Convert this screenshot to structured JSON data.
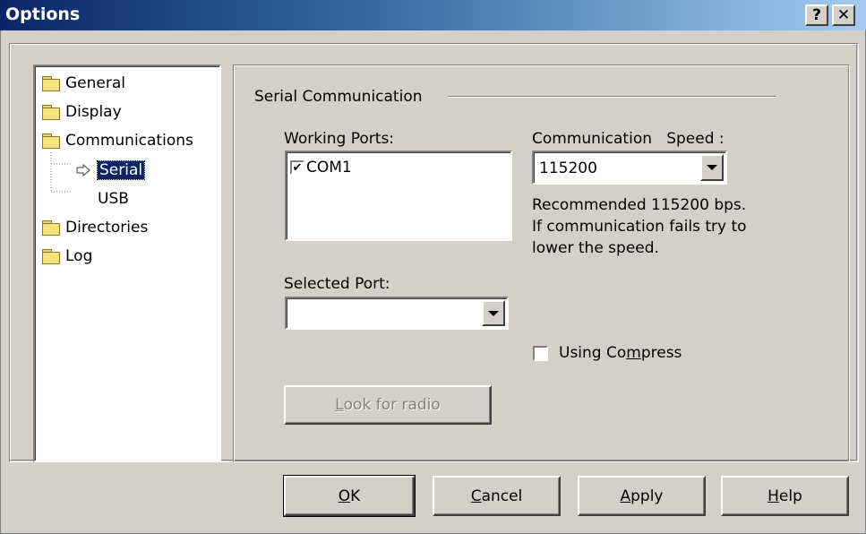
{
  "window": {
    "title": "Options",
    "help_glyph": "?",
    "close_glyph": "✕"
  },
  "tree": {
    "items": [
      {
        "label": "General",
        "icon": "folder-icon"
      },
      {
        "label": "Display",
        "icon": "folder-icon"
      },
      {
        "label": "Communications",
        "icon": "folder-icon"
      },
      {
        "label": "Serial",
        "icon": "arrow-right-icon",
        "selected": true
      },
      {
        "label": "USB"
      },
      {
        "label": "Directories",
        "icon": "folder-icon"
      },
      {
        "label": "Log",
        "icon": "folder-icon"
      }
    ]
  },
  "serial": {
    "group_label": "Serial Communication",
    "working_ports_label": "Working Ports:",
    "ports": [
      {
        "name": "COM1",
        "checked": true
      }
    ],
    "speed_label": "Communication   Speed :",
    "speed_value": "115200",
    "note_line1": "Recommended 115200 bps.",
    "note_line2": "If communication fails try to",
    "note_line3": "lower the speed.",
    "selected_port_label": "Selected Port:",
    "selected_port_value": "",
    "compress_pre": "Using Co",
    "compress_acc": "m",
    "compress_post": "press",
    "compress_checked": false,
    "look_acc": "L",
    "look_rest": "ook for radio"
  },
  "buttons": {
    "ok_acc": "O",
    "ok_rest": "K",
    "cancel_acc": "C",
    "cancel_rest": "ancel",
    "apply_acc": "A",
    "apply_rest": "pply",
    "help_acc": "H",
    "help_rest": "elp"
  },
  "colors": {
    "face": "#d4d0c8",
    "title_start": "#0a246a",
    "title_end": "#a6caf0",
    "selection": "#0a246a"
  }
}
